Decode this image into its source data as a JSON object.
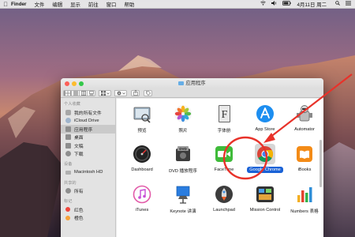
{
  "menubar": {
    "apple": "",
    "app_name": "Finder",
    "items": [
      "文件",
      "编辑",
      "显示",
      "前往",
      "窗口",
      "帮助"
    ],
    "clock": "4月11日 周二",
    "icons": [
      "wifi-icon",
      "volume-icon",
      "battery-icon",
      "spotlight-icon",
      "list-icon"
    ]
  },
  "window": {
    "title": "应用程序",
    "traffic_lights": [
      "#fc5f57",
      "#fdbc2e",
      "#34c84a"
    ]
  },
  "sidebar": {
    "favorites_header": "个人收藏",
    "favorites": [
      {
        "label": "我的所有文件",
        "icon": "files-icon"
      },
      {
        "label": "iCloud Drive",
        "icon": "cloud-icon"
      },
      {
        "label": "应用程序",
        "icon": "apps-icon",
        "selected": true
      },
      {
        "label": "桌面",
        "icon": "desktop-icon"
      },
      {
        "label": "文稿",
        "icon": "documents-icon"
      },
      {
        "label": "下载",
        "icon": "downloads-icon"
      }
    ],
    "devices_header": "设备",
    "devices": [
      {
        "label": "Macintosh HD",
        "icon": "disk-icon"
      }
    ],
    "shared_header": "共享的",
    "shared": [
      {
        "label": "所有",
        "icon": "network-icon"
      }
    ],
    "tags_header": "标记",
    "tags": [
      {
        "label": "红色",
        "color": "#f0463c"
      },
      {
        "label": "橙色",
        "color": "#f6a23a"
      }
    ]
  },
  "apps": [
    {
      "label": "预览",
      "icon": "preview-icon"
    },
    {
      "label": "照片",
      "icon": "photos-icon"
    },
    {
      "label": "字体册",
      "icon": "fontbook-icon"
    },
    {
      "label": "App Store",
      "icon": "appstore-icon"
    },
    {
      "label": "Automator",
      "icon": "automator-icon"
    },
    {
      "label": "Dashboard",
      "icon": "dashboard-icon"
    },
    {
      "label": "DVD 播放程序",
      "icon": "dvd-icon"
    },
    {
      "label": "FaceTime",
      "icon": "facetime-icon"
    },
    {
      "label": "Google Chrome",
      "icon": "chrome-icon",
      "selected": true
    },
    {
      "label": "iBooks",
      "icon": "ibooks-icon"
    },
    {
      "label": "iTunes",
      "icon": "itunes-icon"
    },
    {
      "label": "Keynote 讲演",
      "icon": "keynote-icon"
    },
    {
      "label": "Launchpad",
      "icon": "launchpad-icon"
    },
    {
      "label": "Mission Control",
      "icon": "missioncontrol-icon"
    },
    {
      "label": "Numbers 表格",
      "icon": "numbers-icon"
    }
  ],
  "annotation": {
    "color": "#e8322a"
  }
}
